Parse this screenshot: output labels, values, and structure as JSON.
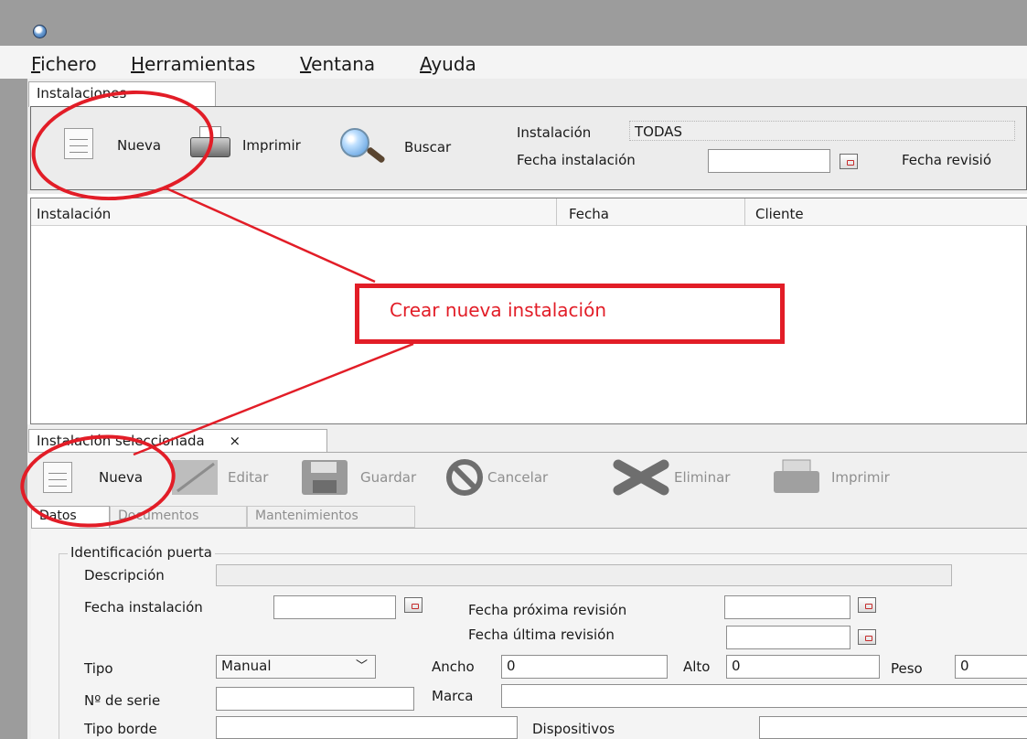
{
  "menu": {
    "items": [
      {
        "accel": "F",
        "rest": "ichero"
      },
      {
        "accel": "H",
        "rest": "erramientas"
      },
      {
        "accel": "V",
        "rest": "entana"
      },
      {
        "accel": "A",
        "rest": "yuda"
      }
    ]
  },
  "top_panel": {
    "tab_label": "Instalaciones",
    "toolbar": {
      "nueva_label": "Nueva",
      "imprimir_label": "Imprimir",
      "buscar_label": "Buscar"
    },
    "filters": {
      "instalacion_label": "Instalación",
      "instalacion_value": "TODAS",
      "fecha_instalacion_label": "Fecha instalación",
      "fecha_instalacion_value": "",
      "fecha_revision_label": "Fecha revisió"
    },
    "table": {
      "columns": [
        "Instalación",
        "Fecha",
        "Cliente"
      ]
    }
  },
  "annotation": {
    "callout_text": "Crear nueva instalación",
    "color": "#e21d27"
  },
  "bottom_panel": {
    "tab_label": "Instalación seleccionada",
    "tab_close": "×",
    "toolbar": {
      "nueva_label": "Nueva",
      "editar_label": "Editar",
      "guardar_label": "Guardar",
      "cancelar_label": "Cancelar",
      "eliminar_label": "Eliminar",
      "imprimir_label": "Imprimir"
    },
    "subtabs": [
      "Datos",
      "Documentos",
      "Mantenimientos"
    ],
    "form": {
      "group_label": "Identificación puerta",
      "descripcion_label": "Descripción",
      "descripcion_value": "",
      "fecha_instalacion_label": "Fecha instalación",
      "fecha_instalacion_value": "",
      "fecha_proxima_label": "Fecha próxima revisión",
      "fecha_proxima_value": "",
      "fecha_ultima_label": "Fecha última revisión",
      "fecha_ultima_value": "",
      "tipo_label": "Tipo",
      "tipo_value": "Manual",
      "ancho_label": "Ancho",
      "ancho_value": "0",
      "alto_label": "Alto",
      "alto_value": "0",
      "peso_label": "Peso",
      "peso_value": "0",
      "serie_label": "Nº de serie",
      "serie_value": "",
      "marca_label": "Marca",
      "marca_value": "",
      "tipo_borde_label": "Tipo borde",
      "tipo_borde_value": "",
      "dispositivos_label": "Dispositivos",
      "dispositivos_value": ""
    }
  }
}
